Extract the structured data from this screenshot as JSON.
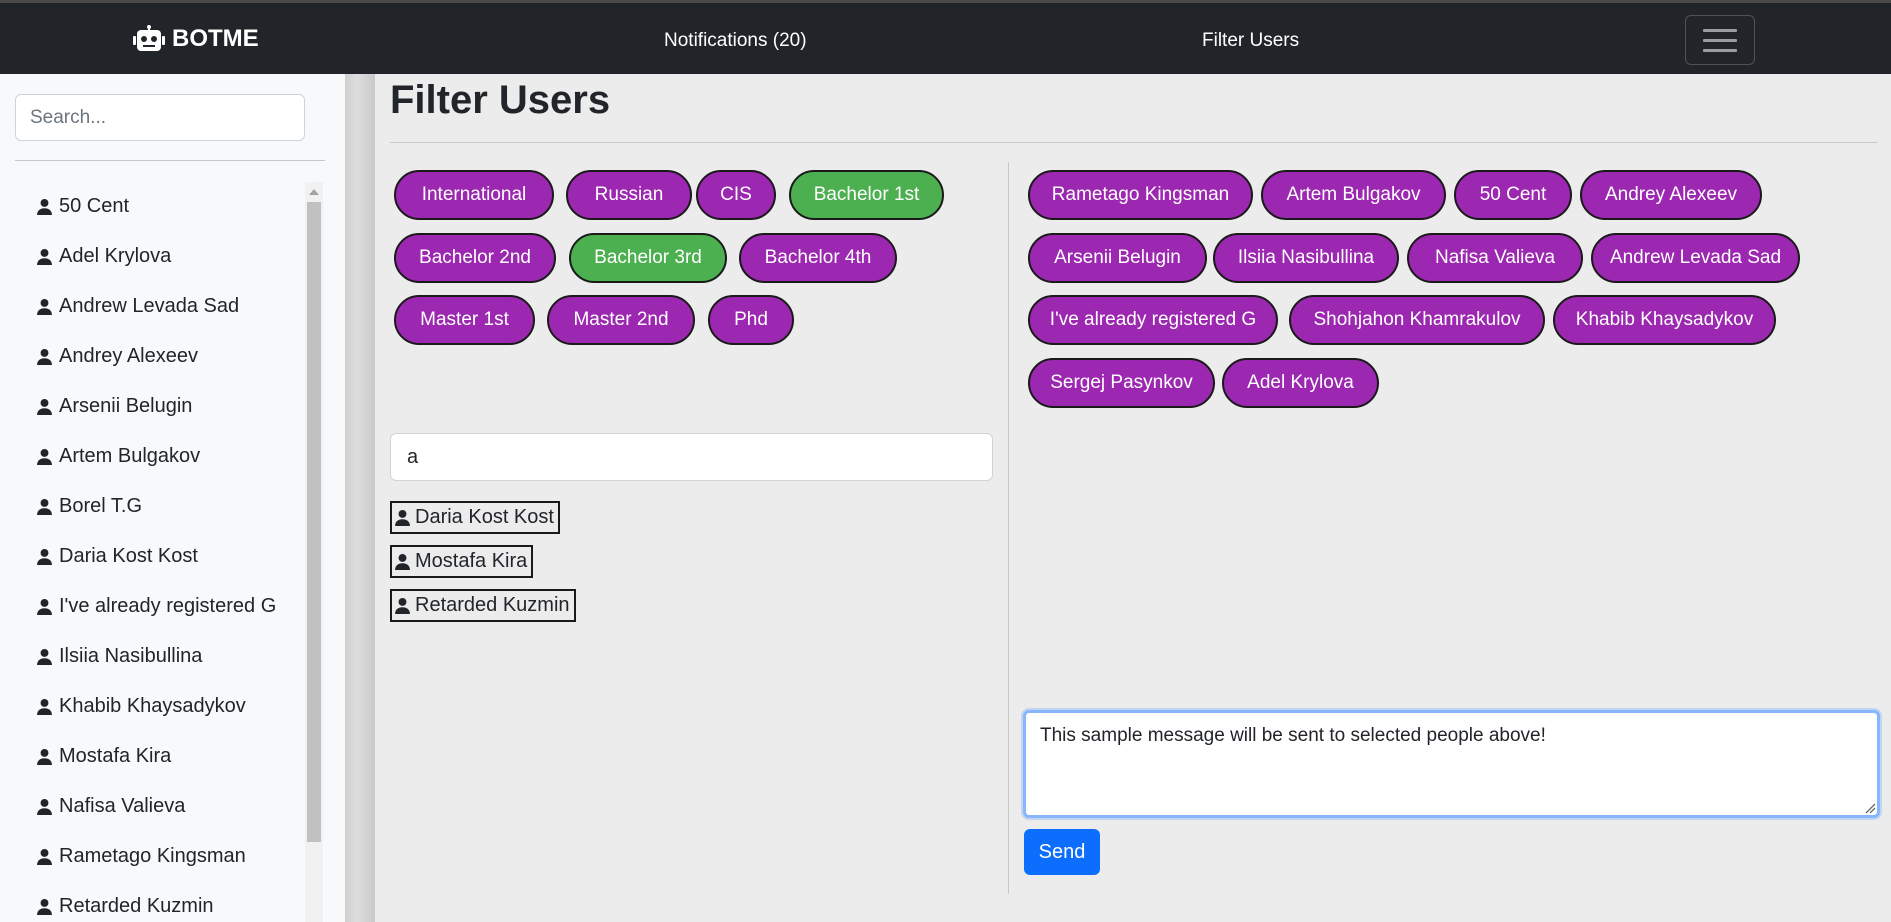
{
  "navbar": {
    "brand": "BOTME",
    "notifications_label": "Notifications (20)",
    "filter_users_label": "Filter Users"
  },
  "sidebar": {
    "search_placeholder": "Search...",
    "users": [
      "50 Cent",
      "Adel Krylova",
      "Andrew Levada Sad",
      "Andrey Alexeev",
      "Arsenii Belugin",
      "Artem Bulgakov",
      "Borel T.G",
      "Daria Kost Kost",
      "I've already registered G",
      "Ilsiia Nasibullina",
      "Khabib Khaysadykov",
      "Mostafa Kira",
      "Nafisa Valieva",
      "Rametago Kingsman",
      "Retarded Kuzmin"
    ]
  },
  "main": {
    "title": "Filter Users",
    "filter_tags": [
      {
        "label": "International",
        "selected": false
      },
      {
        "label": "Russian",
        "selected": false
      },
      {
        "label": "CIS",
        "selected": false
      },
      {
        "label": "Bachelor 1st",
        "selected": true
      },
      {
        "label": "Bachelor 2nd",
        "selected": false
      },
      {
        "label": "Bachelor 3rd",
        "selected": true
      },
      {
        "label": "Bachelor 4th",
        "selected": false
      },
      {
        "label": "Master 1st",
        "selected": false
      },
      {
        "label": "Master 2nd",
        "selected": false
      },
      {
        "label": "Phd",
        "selected": false
      }
    ],
    "user_filter_value": "a",
    "search_results": [
      "Daria Kost Kost",
      "Mostafa Kira",
      "Retarded Kuzmin"
    ],
    "selected_users": [
      "Rametago Kingsman",
      "Artem Bulgakov",
      "50 Cent",
      "Andrey Alexeev",
      "Arsenii Belugin",
      "Ilsiia Nasibullina",
      "Nafisa Valieva",
      "Andrew Levada Sad",
      "I've already registered G",
      "Shohjahon Khamrakulov",
      "Khabib Khaysadykov",
      "Sergej Pasynkov",
      "Adel Krylova"
    ],
    "message_text": "This sample message will be sent to selected people above!",
    "send_label": "Send"
  },
  "colors": {
    "navbar": "#212529",
    "pill_default": "#9c27b0",
    "pill_selected": "#4caf50",
    "send_button": "#0d6efd"
  },
  "icons": {
    "brand": "robot-icon",
    "user": "person-icon",
    "menu": "hamburger-icon"
  }
}
